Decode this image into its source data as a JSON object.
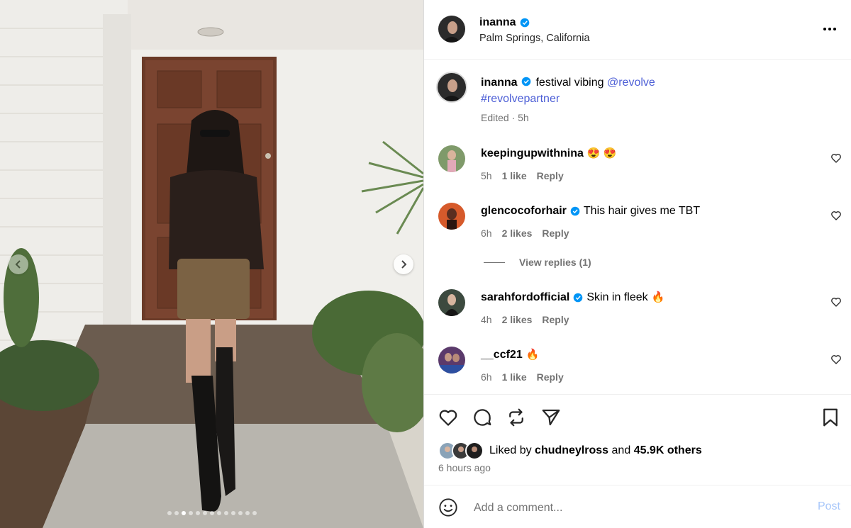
{
  "header": {
    "username": "inanna",
    "location": "Palm Springs, California"
  },
  "caption": {
    "username": "inanna",
    "text": "festival vibing",
    "mention": "@revolve",
    "hashtag": "#revolvepartner",
    "meta": "Edited · 5h"
  },
  "comments": [
    {
      "username": "keepingupwithnina",
      "verified": false,
      "text": "",
      "emoji": "😍 😍",
      "time": "5h",
      "likes": "1 like",
      "reply": "Reply"
    },
    {
      "username": "glencocoforhair",
      "verified": true,
      "text": "This hair gives me TBT",
      "emoji": "",
      "time": "6h",
      "likes": "2 likes",
      "reply": "Reply"
    },
    {
      "username": "sarahfordofficial",
      "verified": true,
      "text": "Skin in fleek",
      "emoji": "🔥",
      "time": "4h",
      "likes": "2 likes",
      "reply": "Reply"
    },
    {
      "username": "__ccf21",
      "verified": false,
      "text": "",
      "emoji": "🔥",
      "time": "6h",
      "likes": "1 like",
      "reply": "Reply"
    }
  ],
  "view_replies": "View replies (1)",
  "likes": {
    "prefix": "Liked by",
    "user": "chudneylross",
    "and": "and",
    "others": "45.9K others"
  },
  "time_ago": "6 hours ago",
  "add_comment": {
    "placeholder": "Add a comment...",
    "post_label": "Post"
  },
  "carousel": {
    "total": 13,
    "active_index": 2
  },
  "colors": {
    "verified": "#0095f6",
    "link": "#4d5fd6",
    "muted": "#737373",
    "post_disabled": "#a8c7fa"
  },
  "icons": [
    "verified-badge-icon",
    "more-icon",
    "heart-icon",
    "comment-icon",
    "repost-icon",
    "share-icon",
    "bookmark-icon",
    "emoji-icon",
    "chevron-left-icon",
    "chevron-right-icon"
  ]
}
